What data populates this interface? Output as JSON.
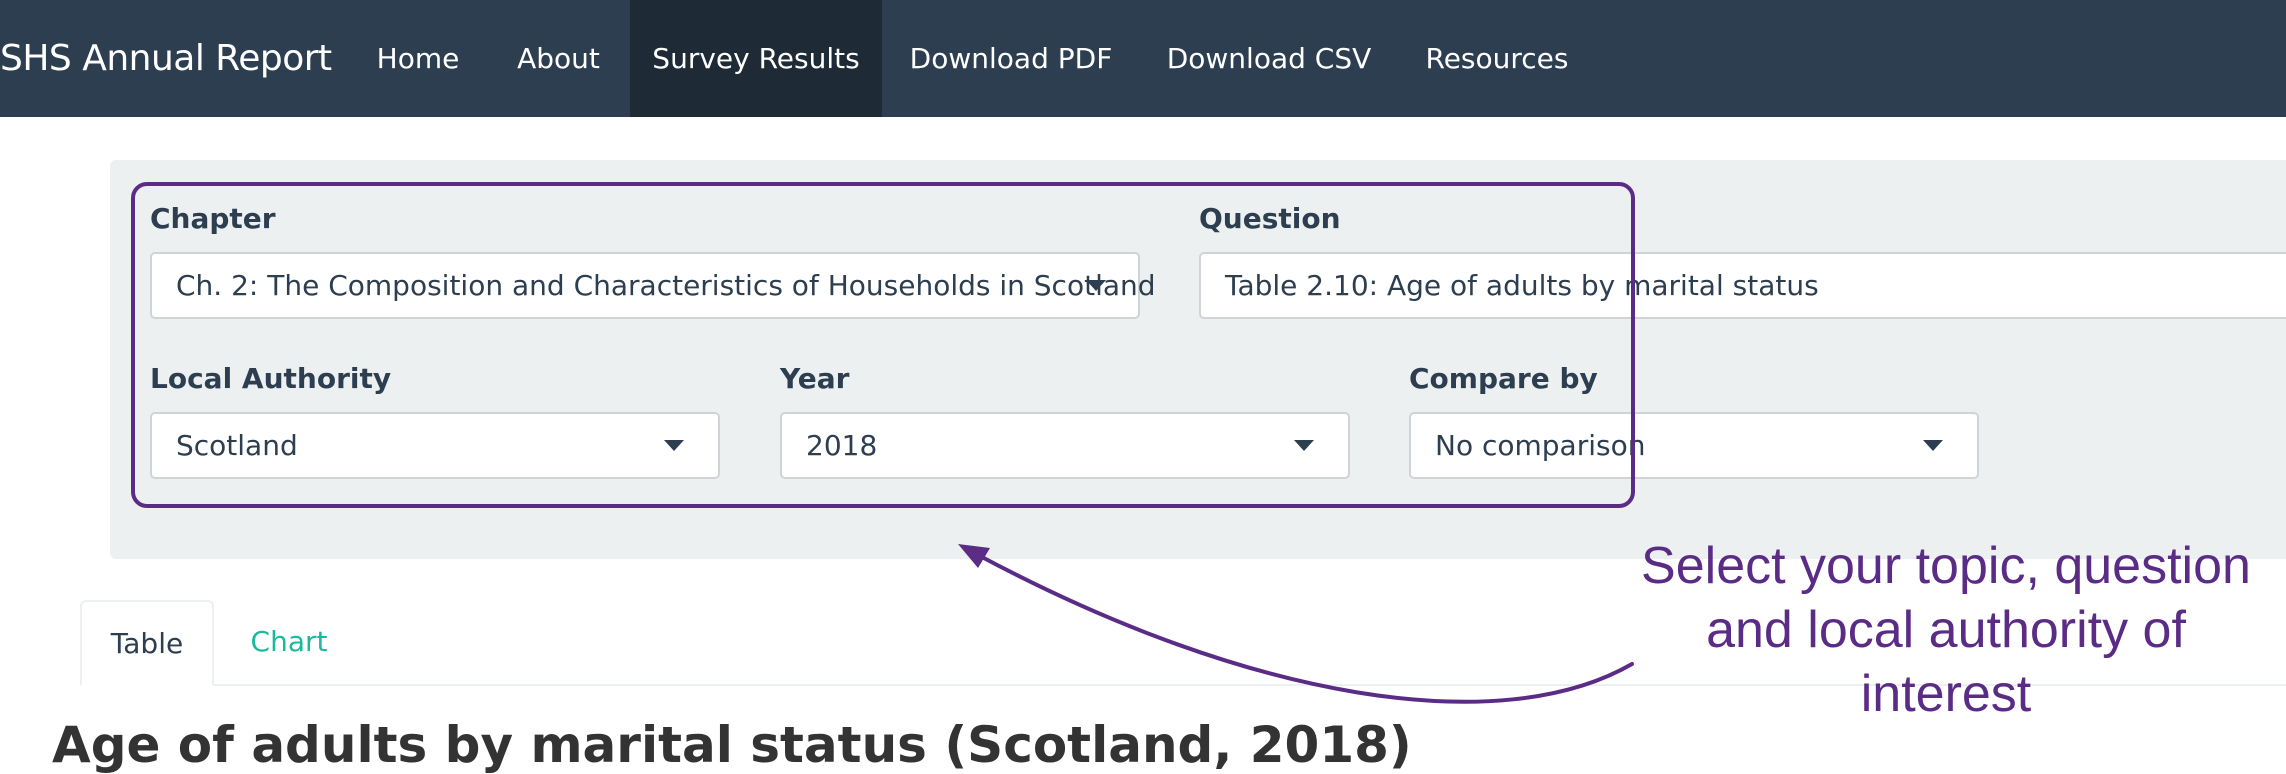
{
  "navbar": {
    "brand": "SHS Annual Report",
    "items": [
      {
        "label": "Home"
      },
      {
        "label": "About"
      },
      {
        "label": "Survey Results",
        "active": true
      },
      {
        "label": "Download PDF"
      },
      {
        "label": "Download CSV"
      },
      {
        "label": "Resources"
      }
    ]
  },
  "filters": {
    "chapter": {
      "label": "Chapter",
      "value": "Ch. 2: The Composition and Characteristics of Households in Scotland"
    },
    "question": {
      "label": "Question",
      "value": "Table 2.10: Age of adults by marital status"
    },
    "local_authority": {
      "label": "Local Authority",
      "value": "Scotland"
    },
    "year": {
      "label": "Year",
      "value": "2018"
    },
    "compare_by": {
      "label": "Compare by",
      "value": "No comparison"
    }
  },
  "tabs": [
    {
      "label": "Table",
      "active": true
    },
    {
      "label": "Chart",
      "active": false
    }
  ],
  "table_heading": "Age of adults by marital status (Scotland, 2018)",
  "annotation": {
    "text": "Select your topic, question and local authority of interest"
  },
  "colors": {
    "navbar_bg": "#2c3e50",
    "navbar_active_bg": "#1e2a35",
    "panel_bg": "#ecf0f1",
    "tab_inactive": "#18bc9c",
    "annotation": "#5b2c86"
  }
}
